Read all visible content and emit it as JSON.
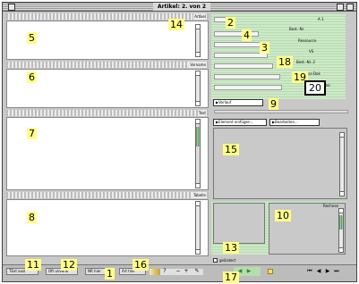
{
  "window": {
    "title": "Artikel: 2. von 2"
  },
  "sections": [
    {
      "id": "5",
      "label": "Artikel"
    },
    {
      "id": "6",
      "label": "Vorname"
    },
    {
      "id": "7",
      "label": "Text"
    },
    {
      "id": "8",
      "label": "Tabelle"
    }
  ],
  "markers": [
    "1",
    "2",
    "3",
    "4",
    "5",
    "6",
    "7",
    "8",
    "9",
    "10",
    "11",
    "12",
    "13",
    "14",
    "15",
    "16",
    "17",
    "18",
    "19",
    "20"
  ],
  "right_labels": {
    "a": "A 1",
    "best_nr": "Best.-Nr.",
    "ressource": "Ressource",
    "vs": "VS",
    "best_nr_2": "Best.-Nr. 2",
    "press_dok": "Press-Dok",
    "datei": "Datei"
  },
  "buttons": {
    "vorlauf": "Vorlauf",
    "element_einfuegen": "Element einfügen...",
    "bearbeiten": "Bearbeiten..."
  },
  "checkbox": {
    "label": "geändert"
  },
  "right_lower_label": "Rechnen",
  "footer": {
    "field1": "TExt ausf",
    "field2": "Oft unverw",
    "field3": "NR hier",
    "field4": "Art hier"
  },
  "colors": {
    "highlight": "#ffff88",
    "green": "#b7dcb0"
  }
}
